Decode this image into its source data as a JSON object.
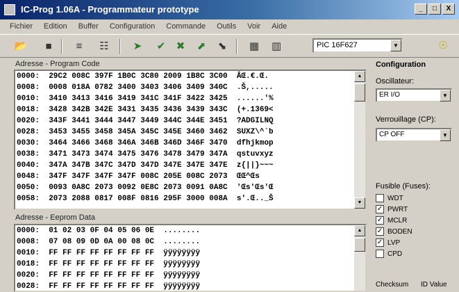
{
  "window": {
    "title": "IC-Prog 1.06A - Programmateur prototype",
    "controls": [
      "_",
      "□",
      "X"
    ]
  },
  "menu": [
    "Fichier",
    "Edition",
    "Buffer",
    "Configuration",
    "Commande",
    "Outils",
    "Voir",
    "Aide"
  ],
  "toolbar": {
    "icons": [
      "open-icon",
      "save-icon",
      "read-icon",
      "chip-icon",
      "program-icon",
      "verify-icon",
      "erase-icon",
      "blank-icon",
      "view-icon",
      "compare-icon",
      "help-icon"
    ],
    "device": "PIC 16F627"
  },
  "program_code": {
    "title": "Adresse - Program Code",
    "rows": [
      "0000:  29C2 008C 397F 1B0C 3C80 2009 1B8C 3C00  ÂŒ.€.Œ.",
      "0008:  0008 018A 0782 3400 3403 3406 3409 340C  .Š,.....",
      "0010:  3410 3413 3416 3419 341C 341F 3422 3425  ......'%",
      "0018:  3428 342B 342E 3431 3435 3436 3439 343C  (+.1369<",
      "0020:  343F 3441 3444 3447 3449 344C 344E 3451  ?ADGILNQ",
      "0028:  3453 3455 3458 345A 345C 345E 3460 3462  SUXZ\\^`b",
      "0030:  3464 3466 3468 346A 346B 346D 346F 3470  dfhjkmop",
      "0038:  3471 3473 3474 3475 3476 3478 3479 347A  qstuvxyz",
      "0040:  347A 347B 347C 347D 347D 347E 347E 347E  z{||}~~~",
      "0048:  347F 347F 347F 347F 008C 205E 008C 2073  ŒŒ^Œs",
      "0050:  0093 0A8C 2073 0092 0E8C 2073 0091 0A8C  'Œs'Œs'Œ",
      "0058:  2073 2088 0817 008F 0816 295F 3000 008A  s'.Œ.._Š"
    ]
  },
  "eeprom": {
    "title": "Adresse - Eeprom Data",
    "rows": [
      "0000:  01 02 03 0F 04 05 06 0E  ........",
      "0008:  07 08 09 0D 0A 00 08 0C  ........",
      "0010:  FF FF FF FF FF FF FF FF  ÿÿÿÿÿÿÿÿ",
      "0018:  FF FF FF FF FF FF FF FF  ÿÿÿÿÿÿÿÿ",
      "0020:  FF FF FF FF FF FF FF FF  ÿÿÿÿÿÿÿÿ",
      "0028:  FF FF FF FF FF FF FF FF  ÿÿÿÿÿÿÿÿ"
    ]
  },
  "config": {
    "title": "Configuration",
    "oscillator_label": "Oscillateur:",
    "oscillator_value": "ER I/O",
    "lock_label": "Verrouillage (CP):",
    "lock_value": "CP OFF",
    "fuses_label": "Fusible (Fuses):",
    "fuses": [
      {
        "label": "WDT",
        "checked": false
      },
      {
        "label": "PWRT",
        "checked": true
      },
      {
        "label": "MCLR",
        "checked": true
      },
      {
        "label": "BODEN",
        "checked": true
      },
      {
        "label": "LVP",
        "checked": true
      },
      {
        "label": "CPD",
        "checked": false
      }
    ],
    "checksum_label": "Checksum",
    "id_label": "ID Value"
  }
}
